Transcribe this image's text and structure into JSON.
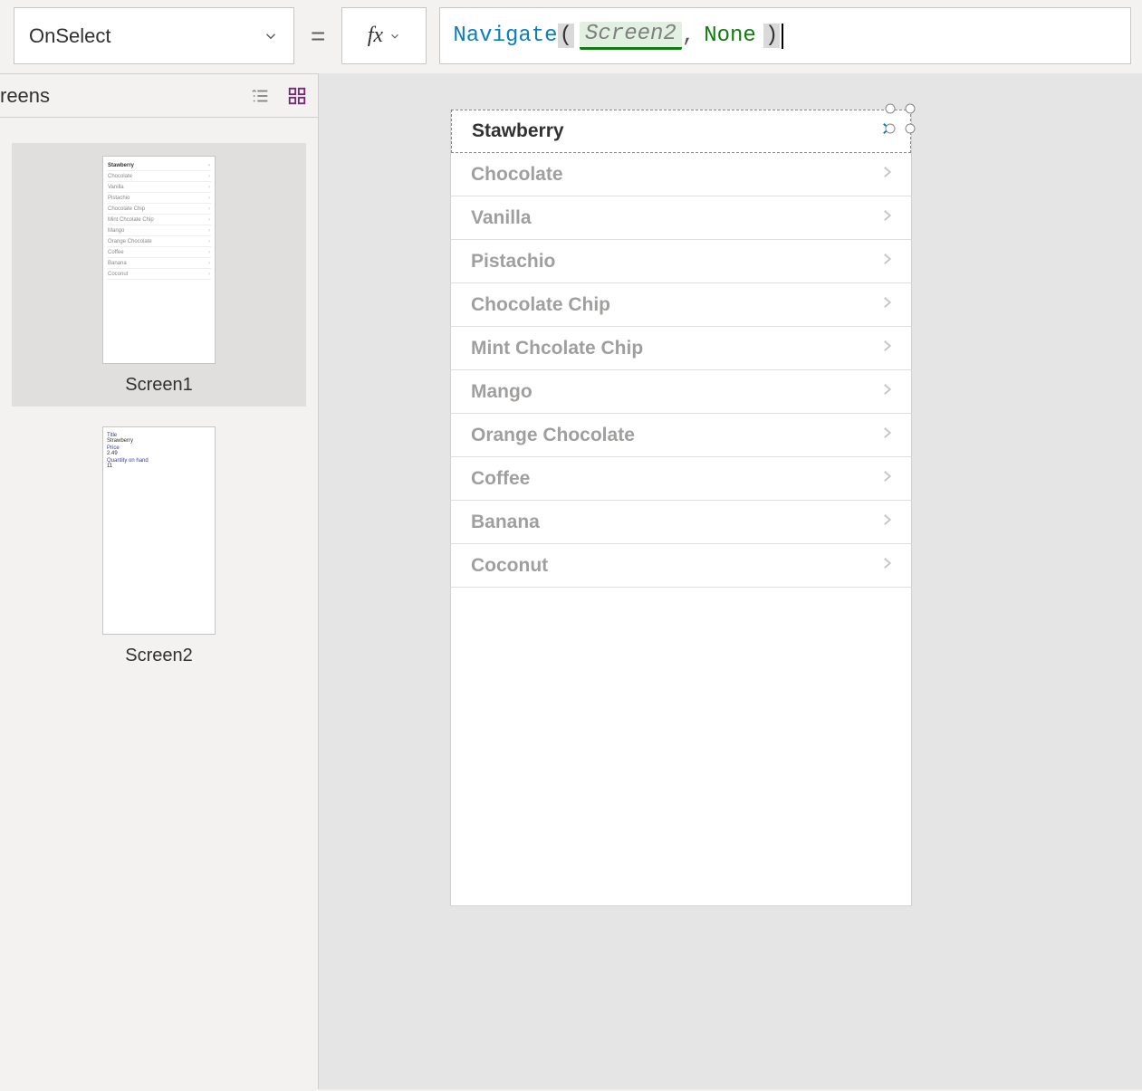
{
  "property_selector": {
    "value": "OnSelect"
  },
  "formula": {
    "func": "Navigate",
    "arg_screen": "Screen2",
    "arg_transition": "None"
  },
  "screens_panel": {
    "title": "reens",
    "thumbnails": [
      {
        "label": "Screen1",
        "selected": true
      },
      {
        "label": "Screen2",
        "selected": false
      }
    ]
  },
  "screen2_detail": {
    "fields": [
      {
        "label": "Title",
        "value": "Strawberry"
      },
      {
        "label": "Price",
        "value": "2.49"
      },
      {
        "label": "Quantity on hand",
        "value": "11"
      }
    ]
  },
  "gallery": {
    "items": [
      {
        "title": "Stawberry",
        "selected": true
      },
      {
        "title": "Chocolate"
      },
      {
        "title": "Vanilla"
      },
      {
        "title": "Pistachio"
      },
      {
        "title": "Chocolate Chip"
      },
      {
        "title": "Mint Chcolate Chip"
      },
      {
        "title": "Mango"
      },
      {
        "title": "Orange Chocolate"
      },
      {
        "title": "Coffee"
      },
      {
        "title": "Banana"
      },
      {
        "title": "Coconut"
      }
    ]
  }
}
